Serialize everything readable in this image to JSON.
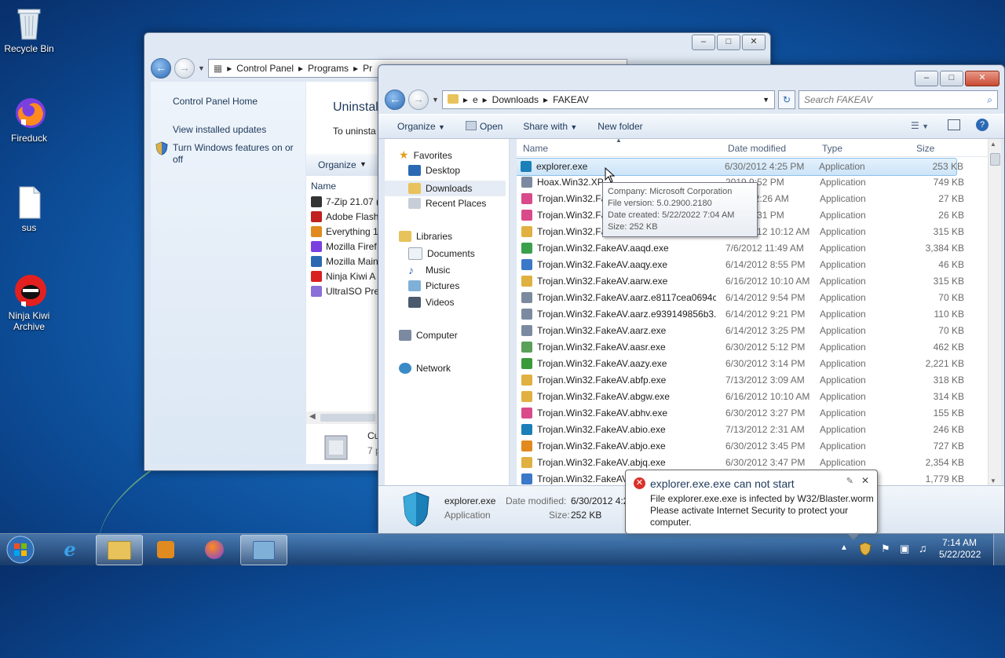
{
  "desktop": {
    "icons": [
      {
        "label": "Recycle Bin",
        "icon": "recycle-bin-icon"
      },
      {
        "label": "Fireduck",
        "icon": "firefox-icon"
      },
      {
        "label": "sus",
        "icon": "document-icon"
      },
      {
        "label": "Ninja Kiwi Archive",
        "icon": "ninja-kiwi-icon"
      }
    ]
  },
  "control_panel": {
    "address": [
      "Control Panel",
      "Programs",
      "Pr"
    ],
    "links": [
      "Control Panel Home",
      "View installed updates",
      "Turn Windows features on or off"
    ],
    "heading": "Uninstal",
    "subheading": "To uninsta",
    "organize": "Organize",
    "column_name": "Name",
    "programs": [
      "7-Zip 21.07 (",
      "Adobe Flash",
      "Everything 1",
      "Mozilla Firef",
      "Mozilla Main",
      "Ninja Kiwi A",
      "UltraISO Pre"
    ],
    "footer_title": "Cu",
    "footer_sub": "7 p"
  },
  "explorer": {
    "address": [
      "e",
      "Downloads",
      "FAKEAV"
    ],
    "search_placeholder": "Search FAKEAV",
    "toolbar": {
      "organize": "Organize",
      "open": "Open",
      "share_with": "Share with",
      "new_folder": "New folder"
    },
    "nav": {
      "favorites": "Favorites",
      "favorites_items": [
        "Desktop",
        "Downloads",
        "Recent Places"
      ],
      "libraries": "Libraries",
      "libraries_items": [
        "Documents",
        "Music",
        "Pictures",
        "Videos"
      ],
      "computer": "Computer",
      "network": "Network"
    },
    "columns": {
      "name": "Name",
      "date": "Date modified",
      "type": "Type",
      "size": "Size"
    },
    "files": [
      {
        "name": "explorer.exe",
        "date": "6/30/2012 4:25 PM",
        "type": "Application",
        "size": "253 KB",
        "color": "#1b7fb8"
      },
      {
        "name": "Hoax.Win32.XP",
        "date": "2019 9:52 PM",
        "type": "Application",
        "size": "749 KB",
        "color": "#7b8aa0"
      },
      {
        "name": "Trojan.Win32.Fa",
        "date": "2012 12:26 AM",
        "type": "Application",
        "size": "27 KB",
        "color": "#d94a8a"
      },
      {
        "name": "Trojan.Win32.Fa",
        "date": "2012 4:31 PM",
        "type": "Application",
        "size": "26 KB",
        "color": "#d94a8a"
      },
      {
        "name": "Trojan.Win32.FakeAV.aaje.exe",
        "date": "6/16/2012 10:12 AM",
        "type": "Application",
        "size": "315 KB",
        "color": "#e0b040"
      },
      {
        "name": "Trojan.Win32.FakeAV.aaqd.exe",
        "date": "7/6/2012 11:49 AM",
        "type": "Application",
        "size": "3,384 KB",
        "color": "#3aa04a"
      },
      {
        "name": "Trojan.Win32.FakeAV.aaqy.exe",
        "date": "6/14/2012 8:55 PM",
        "type": "Application",
        "size": "46 KB",
        "color": "#3a78c8"
      },
      {
        "name": "Trojan.Win32.FakeAV.aarw.exe",
        "date": "6/16/2012 10:10 AM",
        "type": "Application",
        "size": "315 KB",
        "color": "#e0b040"
      },
      {
        "name": "Trojan.Win32.FakeAV.aarz.e8117cea0694c...",
        "date": "6/14/2012 9:54 PM",
        "type": "Application",
        "size": "70 KB",
        "color": "#7b8aa0"
      },
      {
        "name": "Trojan.Win32.FakeAV.aarz.e939149856b3...",
        "date": "6/14/2012 9:21 PM",
        "type": "Application",
        "size": "110 KB",
        "color": "#7b8aa0"
      },
      {
        "name": "Trojan.Win32.FakeAV.aarz.exe",
        "date": "6/14/2012 3:25 PM",
        "type": "Application",
        "size": "70 KB",
        "color": "#7b8aa0"
      },
      {
        "name": "Trojan.Win32.FakeAV.aasr.exe",
        "date": "6/30/2012 5:12 PM",
        "type": "Application",
        "size": "462 KB",
        "color": "#5aa05a"
      },
      {
        "name": "Trojan.Win32.FakeAV.aazy.exe",
        "date": "6/30/2012 3:14 PM",
        "type": "Application",
        "size": "2,221 KB",
        "color": "#3a9a3a"
      },
      {
        "name": "Trojan.Win32.FakeAV.abfp.exe",
        "date": "7/13/2012 3:09 AM",
        "type": "Application",
        "size": "318 KB",
        "color": "#e0b040"
      },
      {
        "name": "Trojan.Win32.FakeAV.abgw.exe",
        "date": "6/16/2012 10:10 AM",
        "type": "Application",
        "size": "314 KB",
        "color": "#e0b040"
      },
      {
        "name": "Trojan.Win32.FakeAV.abhv.exe",
        "date": "6/30/2012 3:27 PM",
        "type": "Application",
        "size": "155 KB",
        "color": "#d94a8a"
      },
      {
        "name": "Trojan.Win32.FakeAV.abio.exe",
        "date": "7/13/2012 2:31 AM",
        "type": "Application",
        "size": "246 KB",
        "color": "#1b7fb8"
      },
      {
        "name": "Trojan.Win32.FakeAV.abjo.exe",
        "date": "6/30/2012 3:45 PM",
        "type": "Application",
        "size": "727 KB",
        "color": "#e08a20"
      },
      {
        "name": "Trojan.Win32.FakeAV.abjq.exe",
        "date": "6/30/2012 3:47 PM",
        "type": "Application",
        "size": "2,354 KB",
        "color": "#e0b040"
      },
      {
        "name": "Trojan.Win32.FakeAV.",
        "date": "",
        "type": "",
        "size": "1,779 KB",
        "color": "#3a78c8"
      }
    ],
    "tooltip": [
      "Company: Microsoft Corporation",
      "File version: 5.0.2900.2180",
      "Date created: 5/22/2022 7:04 AM",
      "Size: 252 KB"
    ],
    "details": {
      "name": "explorer.exe",
      "type": "Application",
      "date_label": "Date modified:",
      "date": "6/30/2012 4:2",
      "size_label": "Size:",
      "size": "252 KB"
    }
  },
  "balloon": {
    "title": "explorer.exe.exe can not start",
    "body": [
      "File explorer.exe.exe is infected by W32/Blaster.worm",
      "Please activate Internet Security to protect your",
      "computer."
    ]
  },
  "taskbar": {
    "time": "7:14 AM",
    "date": "5/22/2022"
  },
  "colors": {
    "selection": "#cce4f8",
    "accent": "#1e395b",
    "error": "#d9312a"
  }
}
